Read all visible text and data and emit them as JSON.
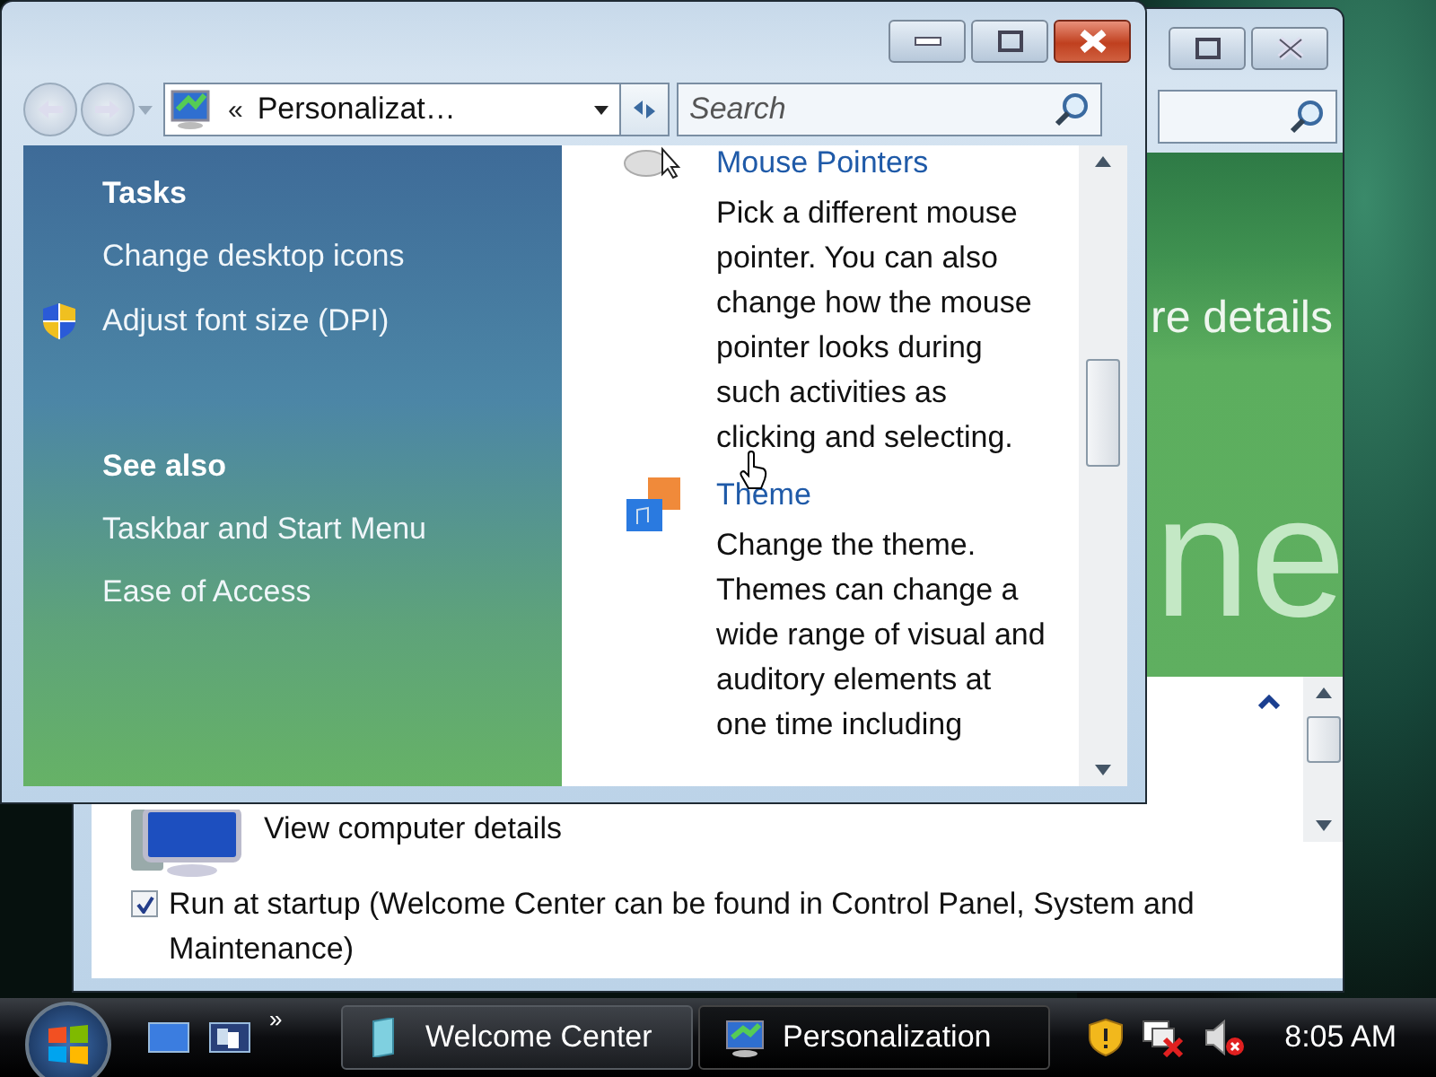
{
  "back_window": {
    "banner_text": "re details",
    "banner_watermark": "ne",
    "task": "View computer details",
    "startup": {
      "label": "Run at startup (Welcome Center can be found in Control Panel, System and Maintenance)",
      "checked": true
    }
  },
  "front_window": {
    "breadcrumb_chevron": "«",
    "address": "Personalizat…",
    "search": {
      "placeholder": "Search"
    },
    "tasks": {
      "heading": "Tasks",
      "items": [
        {
          "label": "Change desktop icons",
          "shield": false
        },
        {
          "label": "Adjust font size (DPI)",
          "shield": true
        }
      ]
    },
    "see_also": {
      "heading": "See also",
      "items": [
        {
          "label": "Taskbar and Start Menu"
        },
        {
          "label": "Ease of Access"
        }
      ]
    },
    "entries": [
      {
        "kind": "mouse",
        "title": "Mouse Pointers",
        "description": "Pick a different mouse pointer. You can also change how the mouse pointer looks during such activities as clicking and selecting."
      },
      {
        "kind": "theme",
        "title": "Theme",
        "description": "Change the theme. Themes can change a wide range of visual and auditory elements at one time including"
      }
    ]
  },
  "taskbar": {
    "quick_launch_chevron": "»",
    "buttons": [
      {
        "label": "Welcome Center",
        "kind": "welcome",
        "selected": false
      },
      {
        "label": "Personalization",
        "kind": "personalization",
        "selected": true
      }
    ],
    "clock": "8:05 AM"
  }
}
